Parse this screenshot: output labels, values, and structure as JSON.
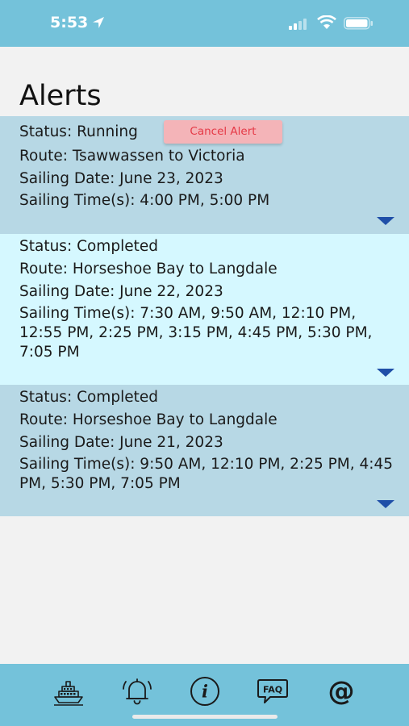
{
  "status_bar": {
    "time": "5:53"
  },
  "page": {
    "title": "Alerts"
  },
  "alerts": [
    {
      "status": "Status: Running",
      "cancel_label": "Cancel Alert",
      "route": "Route: Tsawwassen to Victoria",
      "date": "Sailing Date: June 23, 2023",
      "times": "Sailing Time(s): 4:00 PM, 5:00 PM"
    },
    {
      "status": "Status: Completed",
      "route": "Route: Horseshoe Bay to Langdale",
      "date": "Sailing Date: June 22, 2023",
      "times": "Sailing Time(s): 7:30 AM, 9:50 AM, 12:10 PM, 12:55 PM, 2:25 PM, 3:15 PM, 4:45 PM, 5:30 PM, 7:05 PM"
    },
    {
      "status": "Status: Completed",
      "route": "Route: Horseshoe Bay to Langdale",
      "date": "Sailing Date: June 21, 2023",
      "times": "Sailing Time(s): 9:50 AM, 12:10 PM, 2:25 PM, 4:45 PM, 5:30 PM, 7:05 PM"
    }
  ],
  "tab_bar": {
    "icons": [
      "ferry-icon",
      "alarm-bell-icon",
      "info-icon",
      "faq-icon",
      "at-icon"
    ],
    "faq_text": "FAQ",
    "at_symbol": "@",
    "info_symbol": "i"
  },
  "colors": {
    "bar": "#74c2da",
    "card_dark": "#b7d8e5",
    "card_light": "#d5f8ff",
    "cancel_bg": "#f4b4b8",
    "cancel_text": "#e53946",
    "chevron": "#1f4fa8"
  }
}
